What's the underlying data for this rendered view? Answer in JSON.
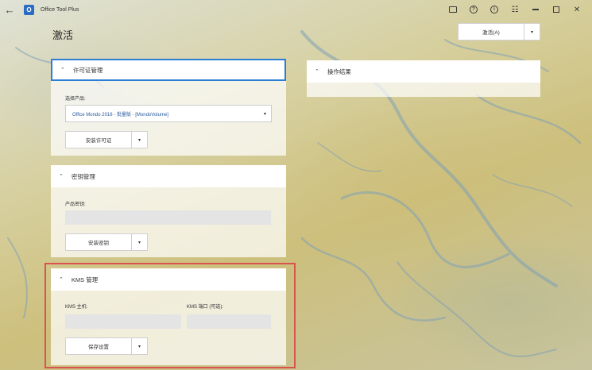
{
  "titlebar": {
    "app_name": "Office Tool Plus",
    "back_glyph": "←",
    "icons": [
      "chat-icon",
      "help-icon",
      "info-icon",
      "settings-sliders-icon",
      "minimize-icon",
      "maximize-icon",
      "close-icon"
    ],
    "help_glyph": "?",
    "info_glyph": "i",
    "settings_glyph": "☷",
    "close_glyph": "✕"
  },
  "page": {
    "title": "激活"
  },
  "activate_button": {
    "label": "激活(A)",
    "dropdown_glyph": "▾"
  },
  "license_panel": {
    "header": "许可证管理",
    "chevron": "⌃",
    "select_label": "选择产品:",
    "selected_product": "Office Mondo 2016 - 批量版 - [MondoVolume]",
    "select_arrow": "▾",
    "install_button": "安装许可证",
    "dropdown_glyph": "▾"
  },
  "key_panel": {
    "header": "密钥管理",
    "chevron": "⌃",
    "key_label": "产品密钥:",
    "key_value": "",
    "install_button": "安装密钥",
    "dropdown_glyph": "▾"
  },
  "kms_panel": {
    "header": "KMS 管理",
    "chevron": "⌃",
    "host_label": "KMS 主机:",
    "host_value": "",
    "port_label": "KMS 端口 (可选):",
    "port_value": "",
    "save_button": "保存设置",
    "dropdown_glyph": "▾"
  },
  "result_panel": {
    "header": "操作结果",
    "chevron": "⌃"
  },
  "colors": {
    "accent": "#2a7fd4",
    "highlight_border": "#d9534f",
    "app_logo": "#2b6cc4"
  }
}
